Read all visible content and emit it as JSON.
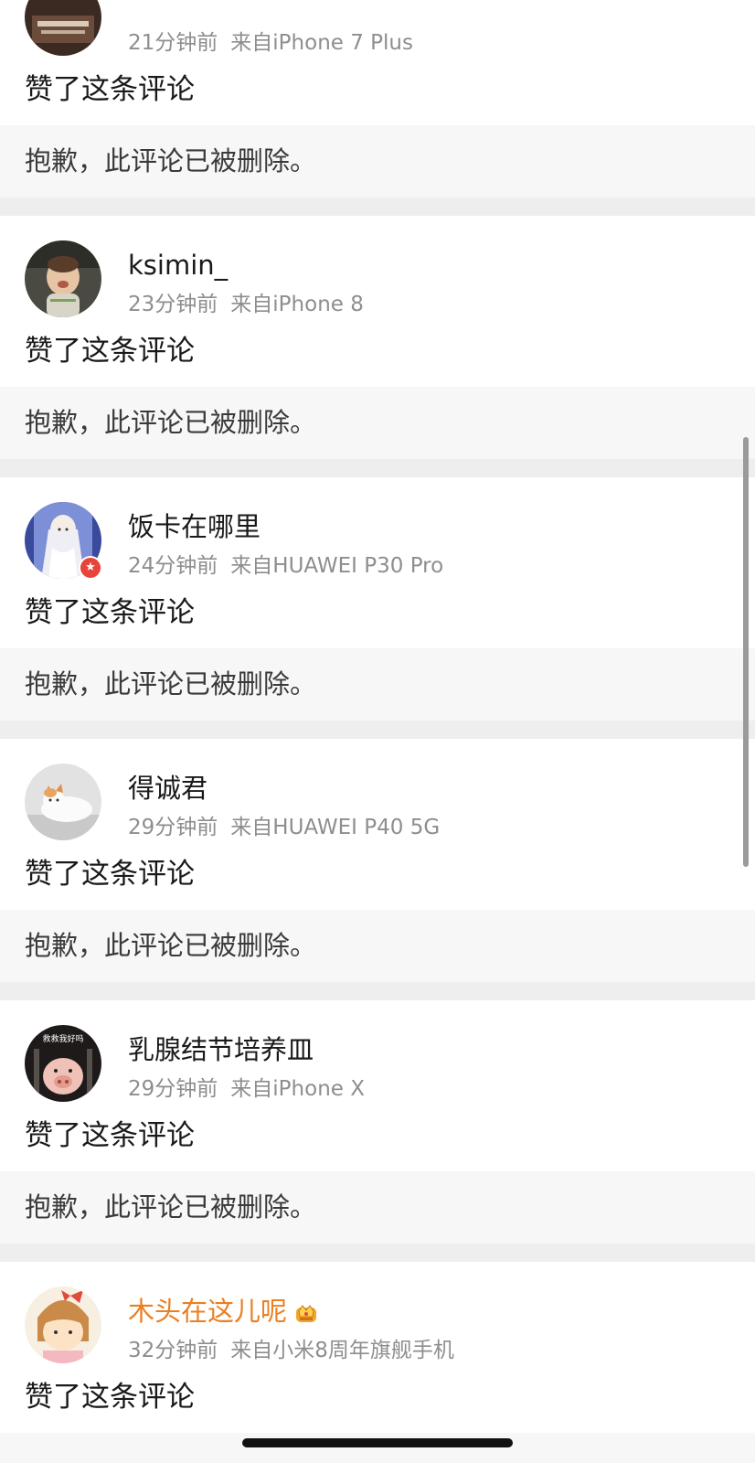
{
  "comments": [
    {
      "user": "",
      "time": "21分钟前",
      "source": "来自iPhone 7 Plus",
      "action": "赞了这条评论",
      "deleted_text": "抱歉，此评论已被删除。"
    },
    {
      "user": "ksimin_",
      "time": "23分钟前",
      "source": "来自iPhone 8",
      "action": "赞了这条评论",
      "deleted_text": "抱歉，此评论已被删除。"
    },
    {
      "user": "饭卡在哪里",
      "time": "24分钟前",
      "source": "来自HUAWEI P30 Pro",
      "action": "赞了这条评论",
      "deleted_text": "抱歉，此评论已被删除。"
    },
    {
      "user": "得诚君",
      "time": "29分钟前",
      "source": "来自HUAWEI P40 5G",
      "action": "赞了这条评论",
      "deleted_text": "抱歉，此评论已被删除。"
    },
    {
      "user": "乳腺结节培养皿",
      "time": "29分钟前",
      "source": "来自iPhone X",
      "action": "赞了这条评论",
      "deleted_text": "抱歉，此评论已被删除。"
    },
    {
      "user": "木头在这儿呢",
      "time": "32分钟前",
      "source": "来自小米8周年旗舰手机",
      "action": "赞了这条评论"
    }
  ],
  "colors": {
    "vip_name": "#eb7f22",
    "verified_badge": "#e8443a",
    "meta_text": "#8e8e8e"
  },
  "avatar_texts": {
    "pig_sign": "救救我好吗"
  }
}
